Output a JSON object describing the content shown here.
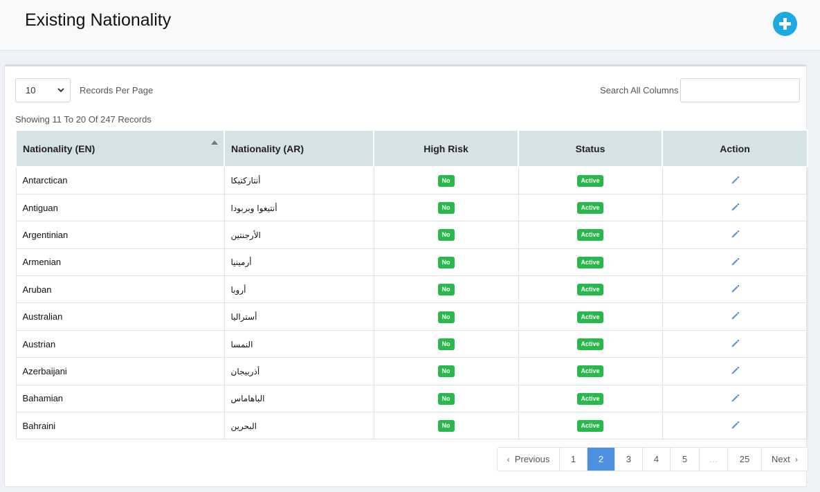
{
  "header": {
    "title": "Existing Nationality"
  },
  "controls": {
    "length_value": "10",
    "length_label": "Records Per Page",
    "search_label": "Search All Columns",
    "search_value": "",
    "info": "Showing 11 To 20 Of 247 Records"
  },
  "table": {
    "columns": [
      "Nationality (EN)",
      "Nationality (AR)",
      "High Risk",
      "Status",
      "Action"
    ],
    "rows": [
      {
        "en": "Antarctican",
        "ar": "أنتاركتيكا",
        "risk": "No",
        "status": "Active"
      },
      {
        "en": "Antiguan",
        "ar": "أنتيغوا وبربودا",
        "risk": "No",
        "status": "Active"
      },
      {
        "en": "Argentinian",
        "ar": "الأرجنتين",
        "risk": "No",
        "status": "Active"
      },
      {
        "en": "Armenian",
        "ar": "أرمينيا",
        "risk": "No",
        "status": "Active"
      },
      {
        "en": "Aruban",
        "ar": "أروبا",
        "risk": "No",
        "status": "Active"
      },
      {
        "en": "Australian",
        "ar": "أستراليا",
        "risk": "No",
        "status": "Active"
      },
      {
        "en": "Austrian",
        "ar": "النمسا",
        "risk": "No",
        "status": "Active"
      },
      {
        "en": "Azerbaijani",
        "ar": "أذربيجان",
        "risk": "No",
        "status": "Active"
      },
      {
        "en": "Bahamian",
        "ar": "الباهاماس",
        "risk": "No",
        "status": "Active"
      },
      {
        "en": "Bahraini",
        "ar": "البحرين",
        "risk": "No",
        "status": "Active"
      }
    ]
  },
  "pagination": {
    "previous": "Previous",
    "next": "Next",
    "pages": [
      "1",
      "2",
      "3",
      "4",
      "5",
      "…",
      "25"
    ],
    "current": "2"
  },
  "colors": {
    "accent": "#1fa9e1",
    "badge_green": "#28b84c",
    "active_page": "#4d8fe0",
    "header_bg": "#d5e2e8"
  },
  "icons": {
    "add": "plus-circle-icon",
    "edit": "pencil-icon",
    "sort": "sort-asc-icon",
    "prev": "chevron-left-icon",
    "next": "chevron-right-icon"
  }
}
